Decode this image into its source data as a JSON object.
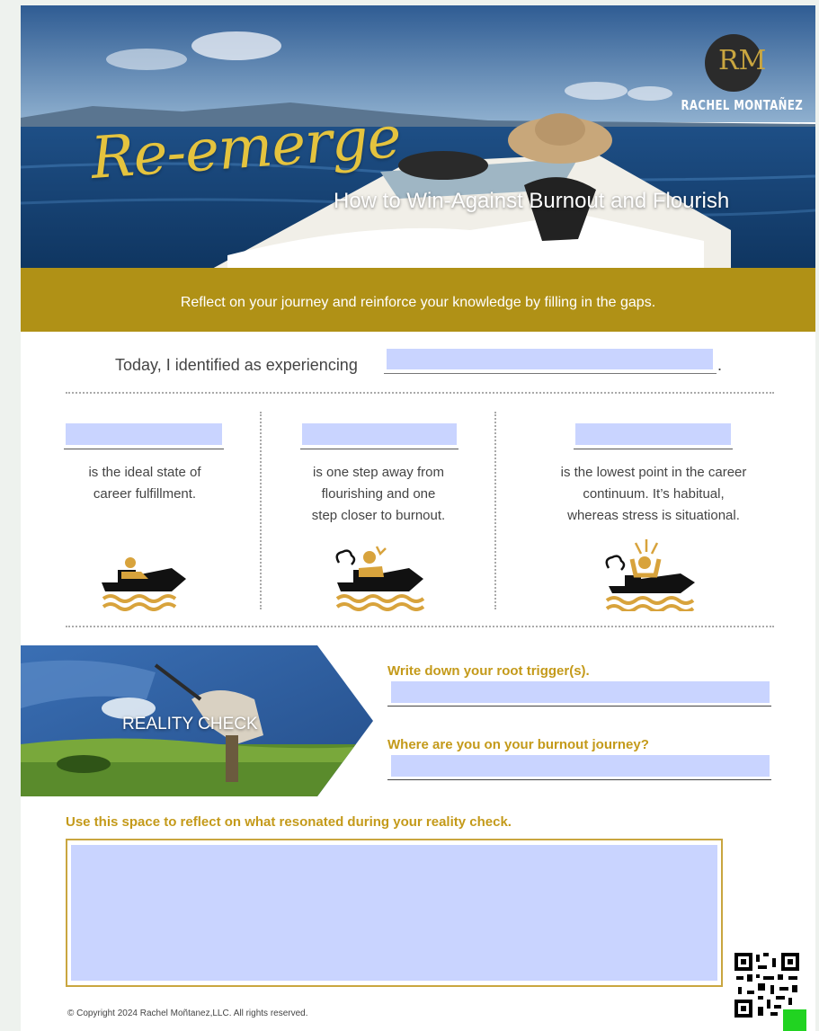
{
  "hero": {
    "script_title": "Re-emerge",
    "subtitle": "How to Win-Against Burnout and Flourish",
    "logo_monogram": "RM",
    "brand_name": "RACHEL MONTAÑEZ",
    "band_text": "Reflect on your journey and reinforce your knowledge by filling in the gaps."
  },
  "today": {
    "prefix": "Today, I identified as experiencing",
    "suffix": ".",
    "value": ""
  },
  "stages": [
    {
      "value": "",
      "line1": "is the ideal state of",
      "line2": "career fulfillment.",
      "line3": ""
    },
    {
      "value": "",
      "line1": "is one step away from",
      "line2": "flourishing and one",
      "line3": "step closer to burnout."
    },
    {
      "value": "",
      "line1": "is the lowest point in the career",
      "line2": "continuum. It’s habitual,",
      "line3": "whereas stress is situational."
    }
  ],
  "reality_check": {
    "banner_label": "REALITY CHECK",
    "q1_label": "Write down your root trigger(s).",
    "q1_value": "",
    "q2_label": "Where are you on your burnout journey?",
    "q2_value": "",
    "reflect_label": "Use this space to reflect on what resonated during your reality check.",
    "reflect_value": ""
  },
  "footer": {
    "copyright": "© Copyright 2024 Rachel Moñtanez,LLC. All rights reserved."
  },
  "colors": {
    "gold": "#c49a1a",
    "field_fill": "#c9d4ff",
    "band": "#b89610",
    "boat": "#111111"
  }
}
